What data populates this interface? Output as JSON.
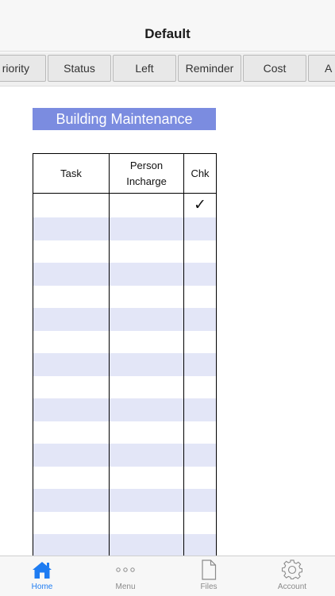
{
  "nav": {
    "title": "Default"
  },
  "tabs": [
    {
      "label": "riority"
    },
    {
      "label": "Status"
    },
    {
      "label": "Left"
    },
    {
      "label": "Reminder"
    },
    {
      "label": "Cost"
    },
    {
      "label": "A"
    }
  ],
  "sheet": {
    "title": "Building Maintenance",
    "columns": {
      "task": "Task",
      "person_line1": "Person",
      "person_line2": "Incharge",
      "chk": "Chk"
    },
    "first_row_check": "✓"
  },
  "tabbar": {
    "home": "Home",
    "menu": "Menu",
    "files": "Files",
    "account": "Account"
  },
  "colors": {
    "accent": "#1e7cf2",
    "title_bar": "#7b8ce0",
    "row_alt": "#e3e6f7"
  }
}
